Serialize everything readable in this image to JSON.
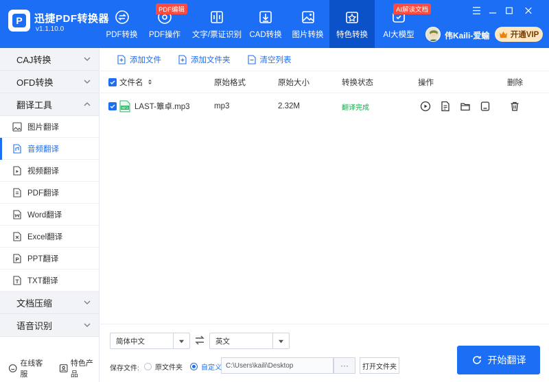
{
  "app": {
    "title": "迅捷PDF转换器",
    "version": "v1.1.10.0",
    "logo_letter": "P"
  },
  "nav": [
    {
      "label": "PDF转换",
      "badge": ""
    },
    {
      "label": "PDF操作",
      "badge": "PDF编辑"
    },
    {
      "label": "文字/票证识别",
      "badge": ""
    },
    {
      "label": "CAD转换",
      "badge": ""
    },
    {
      "label": "图片转换",
      "badge": ""
    },
    {
      "label": "特色转换",
      "badge": ""
    },
    {
      "label": "AI大模型",
      "badge": "AI解读文档"
    }
  ],
  "user": {
    "name": "伟Kaili-爱蝓",
    "vip_label": "开通VIP"
  },
  "sidebar": {
    "categories": [
      {
        "label": "CAJ转换"
      },
      {
        "label": "OFD转换"
      },
      {
        "label": "翻译工具"
      },
      {
        "label": "文档压缩"
      },
      {
        "label": "语音识别"
      }
    ],
    "items": [
      {
        "label": "图片翻译"
      },
      {
        "label": "音频翻译"
      },
      {
        "label": "视频翻译"
      },
      {
        "label": "PDF翻译"
      },
      {
        "label": "Word翻译"
      },
      {
        "label": "Excel翻译"
      },
      {
        "label": "PPT翻译"
      },
      {
        "label": "TXT翻译"
      }
    ],
    "footer": {
      "service": "在线客服",
      "products": "特色产品"
    }
  },
  "toolbar": {
    "add_file": "添加文件",
    "add_folder": "添加文件夹",
    "clear_list": "清空列表"
  },
  "table": {
    "headers": {
      "name": "文件名",
      "format": "原始格式",
      "size": "原始大小",
      "status": "转换状态",
      "ops": "操作",
      "delete": "删除"
    },
    "rows": [
      {
        "name": "LAST-簟卓.mp3",
        "format": "mp3",
        "size": "2.32M",
        "status": "翻译完成",
        "icon_label": "MP3"
      }
    ]
  },
  "bottom": {
    "source_lang": "简体中文",
    "target_lang": "英文",
    "save_label": "保存文件:",
    "radio_original": "原文件夹",
    "radio_custom": "自定义",
    "path": "C:\\Users\\kaili\\Desktop",
    "more": "···",
    "open_folder": "打开文件夹",
    "start": "开始翻译"
  },
  "colors": {
    "accent": "#1c6ef4",
    "success": "#1aa84e",
    "badge": "#ff4a3d",
    "vip_bg": "#ffe7c2"
  }
}
